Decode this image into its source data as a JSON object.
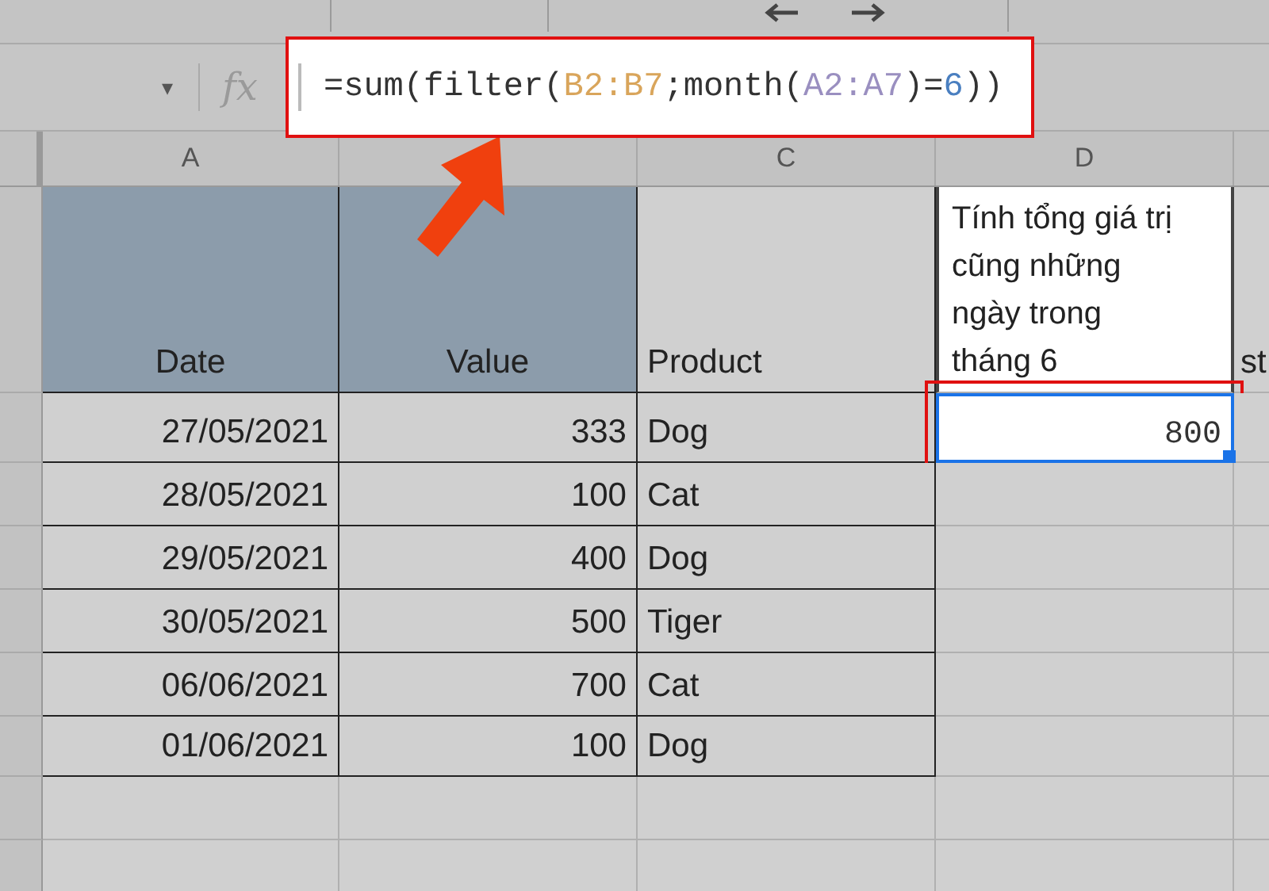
{
  "formula_bar": {
    "name_box_caret": "▾",
    "fx": "fx",
    "formula": [
      {
        "text": "=sum(filter(",
        "color": "#333333"
      },
      {
        "text": "B2:B7",
        "color": "#d9a55b"
      },
      {
        "text": ";month(",
        "color": "#333333"
      },
      {
        "text": "A2:A7",
        "color": "#9a8fc0"
      },
      {
        "text": ")=",
        "color": "#333333"
      },
      {
        "text": "6",
        "color": "#4a7fc0"
      },
      {
        "text": "))",
        "color": "#333333"
      }
    ]
  },
  "columns": [
    "A",
    "",
    "C",
    "D"
  ],
  "header_row": {
    "cells": [
      "Date",
      "Value",
      "Product"
    ],
    "note": [
      "Tính tổng giá trị",
      "cũng những",
      "ngày trong",
      "tháng 6"
    ],
    "column_e": "st"
  },
  "rows": [
    {
      "cells": [
        "27/05/2021",
        "333",
        "Dog"
      ],
      "result": "800",
      "selected": true
    },
    {
      "cells": [
        "28/05/2021",
        "100",
        "Cat"
      ],
      "selected": false
    },
    {
      "cells": [
        "29/05/2021",
        "400",
        "Dog"
      ],
      "selected": false
    },
    {
      "cells": [
        "30/05/2021",
        "500",
        "Tiger"
      ],
      "selected": false
    },
    {
      "cells": [
        "06/06/2021",
        "700",
        "Cat"
      ],
      "selected": false
    },
    {
      "cells": [
        "01/06/2021",
        "100",
        "Dog"
      ],
      "selected": false
    }
  ]
}
